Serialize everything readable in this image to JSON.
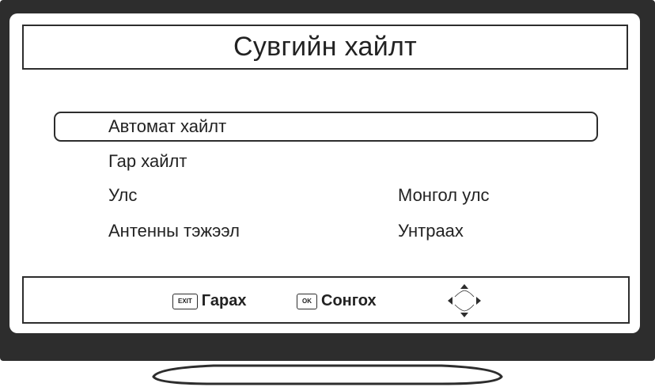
{
  "screen": {
    "title": "Сувгийн хайлт"
  },
  "menu": {
    "items": [
      {
        "label": "Автомат хайлт",
        "value": "",
        "selected": true
      },
      {
        "label": "Гар хайлт",
        "value": ""
      },
      {
        "label": "Улс",
        "value": "Монгол улс"
      },
      {
        "label": "Антенны тэжээл",
        "value": "Унтраах"
      }
    ]
  },
  "footer": {
    "exit_key": "EXIT",
    "exit_label": "Гарах",
    "ok_key": "OK",
    "ok_label": "Сонгох"
  },
  "icons": {
    "navigation": "four-direction-arrows-icon"
  },
  "colors": {
    "frame": "#2d2d2d",
    "screen_bg": "#ffffff",
    "text": "#222222"
  }
}
